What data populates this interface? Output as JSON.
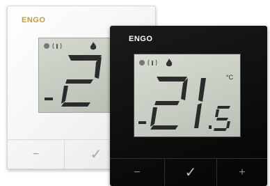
{
  "white_unit": {
    "brand": "ENGO",
    "lcd_value": "2",
    "buttons": [
      "−",
      "✓"
    ]
  },
  "black_unit": {
    "brand": "ENGO",
    "lcd_value": "21.5",
    "unit": "°C",
    "buttons": [
      "−",
      "✓",
      "+"
    ]
  },
  "colors": {
    "brand_gold": "#c79a3a",
    "lcd_bg": "#c6ccc1",
    "segment": "#2b2b2b"
  }
}
